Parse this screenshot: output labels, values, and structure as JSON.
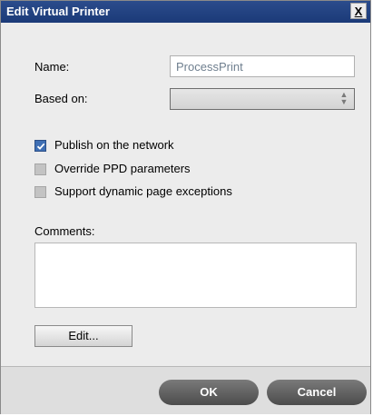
{
  "dialog": {
    "title": "Edit Virtual Printer",
    "close_label": "X"
  },
  "form": {
    "name_label": "Name:",
    "name_value": "ProcessPrint",
    "based_on_label": "Based on:",
    "based_on_value": "",
    "checkboxes": [
      {
        "label": "Publish on the network",
        "checked": true
      },
      {
        "label": "Override PPD parameters",
        "checked": false
      },
      {
        "label": "Support dynamic page exceptions",
        "checked": false
      }
    ],
    "comments_label": "Comments:",
    "comments_value": "",
    "edit_button": "Edit..."
  },
  "footer": {
    "ok_label": "OK",
    "cancel_label": "Cancel"
  },
  "colors": {
    "titlebar": "#1b3a78",
    "checkbox_checked": "#3f6fb4",
    "pill_button": "#5a5a5a"
  },
  "icons": {
    "close": "close-icon",
    "select_arrows": "chevron-updown-icon",
    "checkmark": "checkmark-icon"
  }
}
